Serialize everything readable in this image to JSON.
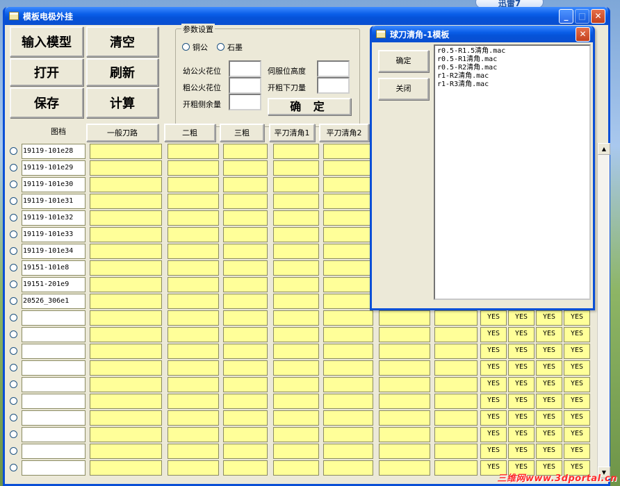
{
  "desktop": {
    "tab_label": "迅雷7"
  },
  "main_window": {
    "title": "模板电极外挂",
    "buttons": {
      "import": "输入模型",
      "clear": "清空",
      "open": "打开",
      "refresh": "刷新",
      "save": "保存",
      "compute": "计算"
    },
    "params": {
      "title": "参数设置",
      "radio_copper": "铜公",
      "radio_graphite": "石墨",
      "fine_spark_label": "幼公火花位",
      "rough_spark_label": "粗公火花位",
      "open_rough_side_label": "开粗侧余量",
      "servo_height_label": "伺服位高度",
      "open_rough_depth_label": "开粗下刀量",
      "confirm_label": "确 定"
    },
    "columns": [
      "图档",
      "一般刀路",
      "二粗",
      "三粗",
      "平刀清角1",
      "平刀清角2"
    ],
    "rows": [
      "19119-101e28",
      "19119-101e29",
      "19119-101e30",
      "19119-101e31",
      "19119-101e32",
      "19119-101e33",
      "19119-101e34",
      "19151-101e8",
      "19151-201e9",
      "20526_306e1",
      "",
      "",
      "",
      "",
      "",
      "",
      "",
      "",
      "",
      ""
    ],
    "yes_text": "YES"
  },
  "dialog": {
    "title": "球刀清角-1模板",
    "ok_label": "确定",
    "close_label": "关闭",
    "list_items": [
      "r0.5-R1.5清角.mac",
      "r0.5-R1清角.mac",
      "r0.5-R2清角.mac",
      "r1-R2清角.mac",
      "r1-R3清角.mac"
    ]
  },
  "watermark": "三维网www.3dportal.cn"
}
